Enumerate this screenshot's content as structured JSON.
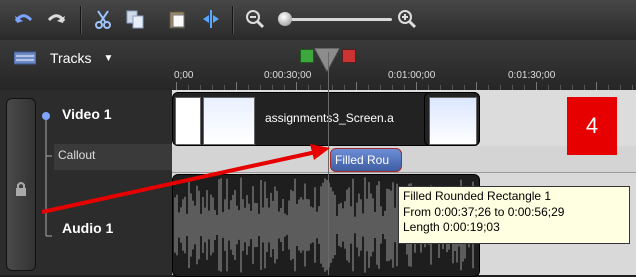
{
  "toolbar": {
    "buttons": [
      {
        "name": "undo-icon"
      },
      {
        "name": "redo-icon"
      },
      {
        "name": "cut-icon"
      },
      {
        "name": "copy-icon"
      },
      {
        "name": "paste-icon"
      },
      {
        "name": "split-icon"
      },
      {
        "name": "zoom-out-icon"
      },
      {
        "name": "zoom-in-icon"
      }
    ]
  },
  "header": {
    "tracks_label": "Tracks",
    "marker_in": "In",
    "marker_out": "Out"
  },
  "ruler": {
    "labels": [
      "0;00",
      "0:00:30;00",
      "0:01:00;00",
      "0:01:30;00"
    ]
  },
  "tracks": {
    "video": {
      "label": "Video 1"
    },
    "callout": {
      "label": "Callout"
    },
    "audio": {
      "label": "Audio 1"
    }
  },
  "clips": {
    "video_main": "assignments3_Screen.a",
    "callout": "Filled Rou"
  },
  "tooltip": {
    "title": "Filled Rounded Rectangle 1",
    "range": "From 0:00:37;26 to 0:00:56;29",
    "length": "Length 0:00:19;03"
  },
  "badge": {
    "number": "4"
  },
  "colors": {
    "annotation_red": "#e60000",
    "callout_clip": "#4f6fb5"
  }
}
